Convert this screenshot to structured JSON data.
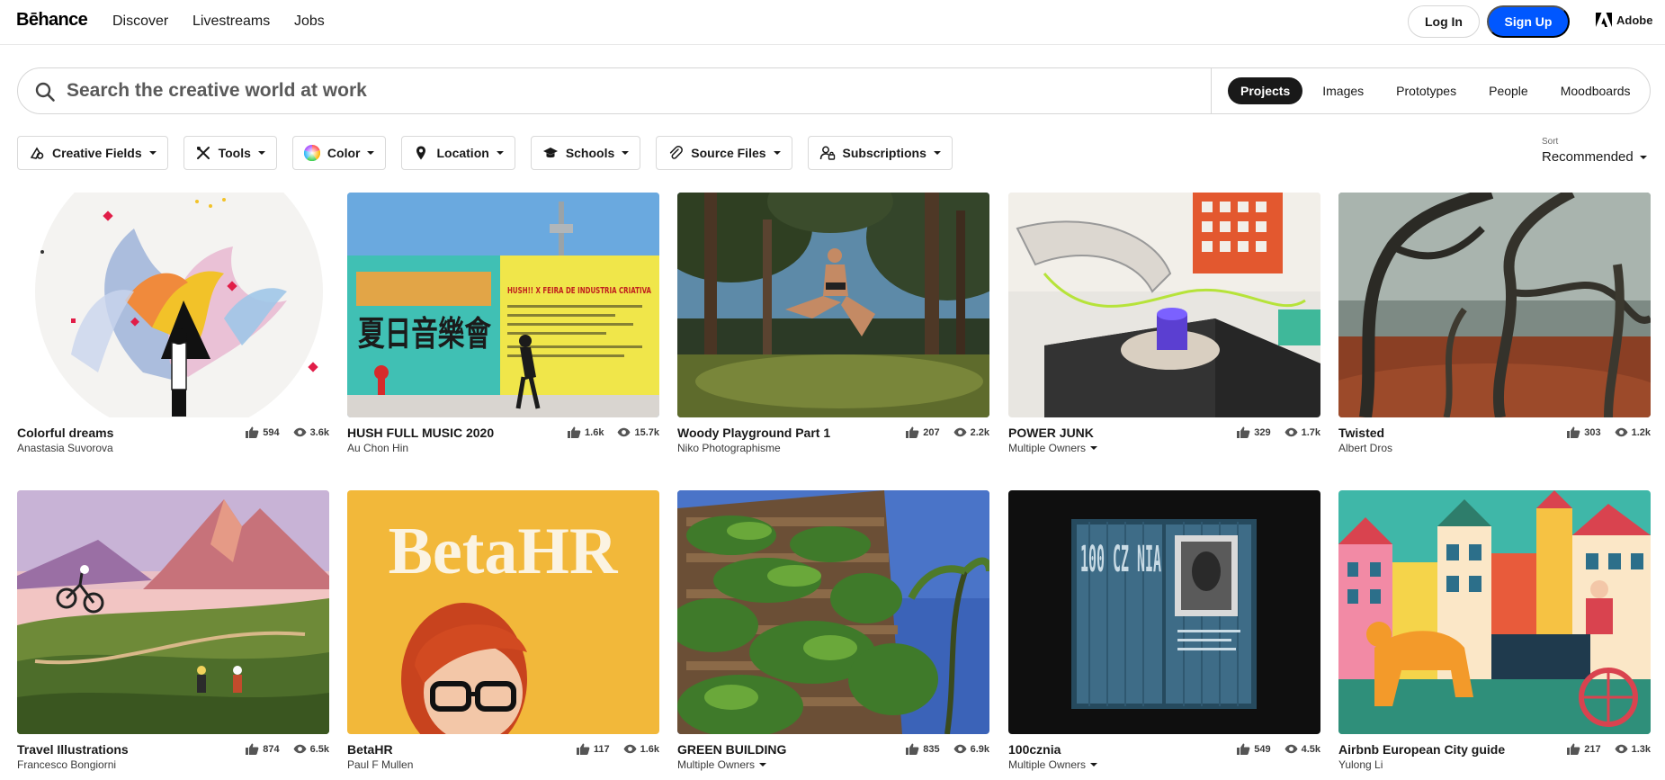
{
  "brand": {
    "logo": "Bēhance"
  },
  "nav": {
    "discover": "Discover",
    "livestreams": "Livestreams",
    "jobs": "Jobs",
    "login": "Log In",
    "signup": "Sign Up",
    "adobe": "Adobe"
  },
  "search": {
    "placeholder": "Search the creative world at work",
    "tabs": [
      "Projects",
      "Images",
      "Prototypes",
      "People",
      "Moodboards"
    ],
    "active_tab": "Projects"
  },
  "filters": {
    "creative_fields": "Creative Fields",
    "tools": "Tools",
    "color": "Color",
    "location": "Location",
    "schools": "Schools",
    "source_files": "Source Files",
    "subscriptions": "Subscriptions"
  },
  "sort": {
    "label": "Sort",
    "value": "Recommended"
  },
  "projects": [
    {
      "title": "Colorful dreams",
      "owner": "Anastasia Suvorova",
      "likes": "594",
      "views": "3.6k"
    },
    {
      "title": "HUSH FULL MUSIC 2020",
      "owner": "Au Chon Hin",
      "likes": "1.6k",
      "views": "15.7k"
    },
    {
      "title": "Woody Playground Part 1",
      "owner": "Niko Photographisme",
      "likes": "207",
      "views": "2.2k"
    },
    {
      "title": "POWER JUNK",
      "owner": "Multiple Owners",
      "likes": "329",
      "views": "1.7k"
    },
    {
      "title": "Twisted",
      "owner": "Albert Dros",
      "likes": "303",
      "views": "1.2k"
    },
    {
      "title": "Travel Illustrations",
      "owner": "Francesco Bongiorni",
      "likes": "874",
      "views": "6.5k"
    },
    {
      "title": "BetaHR",
      "owner": "Paul F Mullen",
      "likes": "117",
      "views": "1.6k"
    },
    {
      "title": "GREEN BUILDING",
      "owner": "Multiple Owners",
      "likes": "835",
      "views": "6.9k"
    },
    {
      "title": "100cznia",
      "owner": "Multiple Owners",
      "likes": "549",
      "views": "4.5k"
    },
    {
      "title": "Airbnb European City guide",
      "owner": "Yulong Li",
      "likes": "217",
      "views": "1.3k"
    }
  ],
  "artwork_text": {
    "betahr": "BetaHR",
    "hush_big": "夏日音樂會",
    "hush_banner": "HUSH!! X FEIRA DE INDUSTRIA CRIATIVA",
    "container": "100 CZ NIA"
  },
  "colors": {
    "accent": "#0057ff",
    "active_tab": "#191919",
    "border": "#d6d6d6"
  }
}
